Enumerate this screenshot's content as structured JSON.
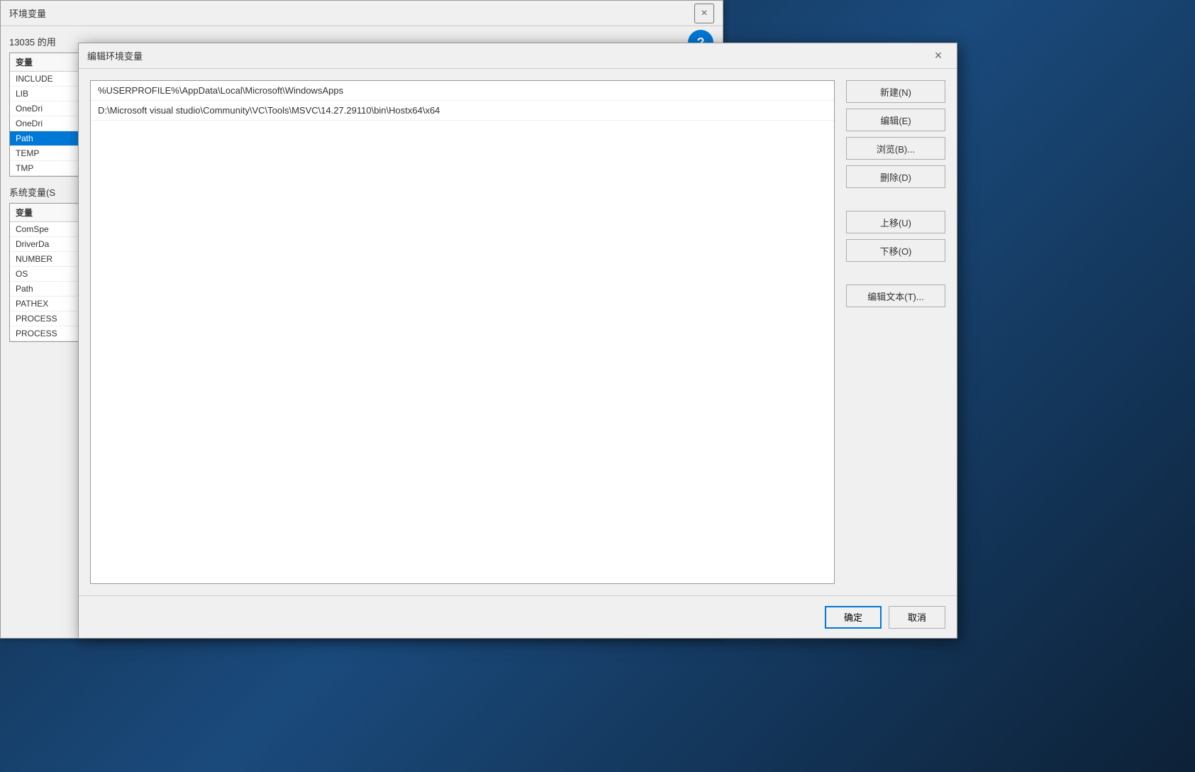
{
  "desktop": {
    "background_color": "#1a3a5c"
  },
  "bg_window": {
    "title": "环境变量",
    "close_label": "×",
    "help_label": "?",
    "user_section_label": "13035 的用",
    "user_table_header": "变量",
    "user_rows": [
      {
        "name": "INCLUDE",
        "selected": false
      },
      {
        "name": "LIB",
        "selected": false
      },
      {
        "name": "OneDri",
        "selected": false
      },
      {
        "name": "OneDri",
        "selected": false
      },
      {
        "name": "Path",
        "selected": true
      },
      {
        "name": "TEMP",
        "selected": false
      },
      {
        "name": "TMP",
        "selected": false
      }
    ],
    "system_section_label": "系统变量(S",
    "system_table_header": "变量",
    "system_rows": [
      {
        "name": "ComSpe",
        "selected": false
      },
      {
        "name": "DriverDa",
        "selected": false
      },
      {
        "name": "NUMBER",
        "selected": false
      },
      {
        "name": "OS",
        "selected": false
      },
      {
        "name": "Path",
        "selected": false
      },
      {
        "name": "PATHEX",
        "selected": false
      },
      {
        "name": "PROCESS",
        "selected": false
      },
      {
        "name": "PROCESS",
        "selected": false
      }
    ]
  },
  "main_dialog": {
    "title": "编辑环境变量",
    "close_label": "×",
    "path_entries": [
      {
        "text": "%USERPROFILE%\\AppData\\Local\\Microsoft\\WindowsApps",
        "selected": false
      },
      {
        "text": "D:\\Microsoft visual studio\\Community\\VC\\Tools\\MSVC\\14.27.29110\\bin\\Hostx64\\x64",
        "selected": false
      }
    ],
    "buttons": {
      "new_label": "新建(N)",
      "edit_label": "编辑(E)",
      "browse_label": "浏览(B)...",
      "delete_label": "删除(D)",
      "move_up_label": "上移(U)",
      "move_down_label": "下移(O)",
      "edit_text_label": "编辑文本(T)..."
    },
    "footer": {
      "ok_label": "确定",
      "cancel_label": "取消"
    }
  }
}
